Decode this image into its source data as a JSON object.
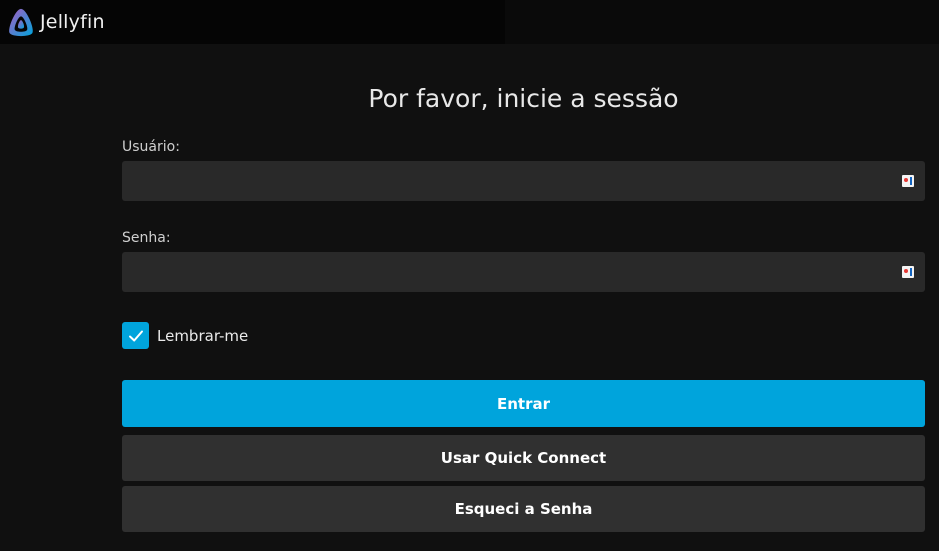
{
  "header": {
    "brand_name": "Jellyfin",
    "logo_icon": "jellyfin-logo-icon"
  },
  "login": {
    "title": "Por favor, inicie a sessão",
    "username_label": "Usuário:",
    "username_value": "",
    "password_label": "Senha:",
    "password_value": "",
    "remember_label": "Lembrar-me",
    "remember_checked": true,
    "submit_label": "Entrar",
    "quick_connect_label": "Usar Quick Connect",
    "forgot_label": "Esqueci a Senha"
  },
  "colors": {
    "accent": "#00a4dc",
    "background": "#101010",
    "field_background": "#292929",
    "secondary_button": "#303030"
  }
}
